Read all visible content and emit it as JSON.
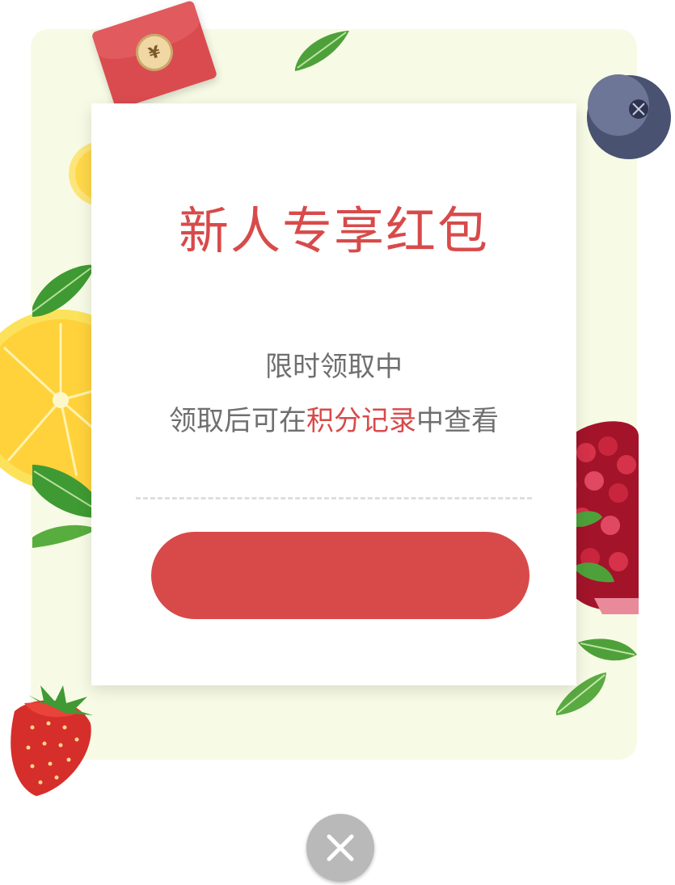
{
  "dialog": {
    "title": "新人专享红包",
    "subtitle": "限时领取中",
    "hint_prefix": "领取后可在",
    "hint_highlight": "积分记录",
    "hint_suffix": "中查看",
    "claim_button_label": ""
  },
  "decorations": {
    "red_packet_symbol": "¥"
  },
  "colors": {
    "accent_red": "#d84a4a",
    "panel_bg": "#f7fbe5",
    "text_gray": "#6f6f6f",
    "close_bg": "#b9b9b9"
  },
  "icons": {
    "close": "close-icon"
  }
}
